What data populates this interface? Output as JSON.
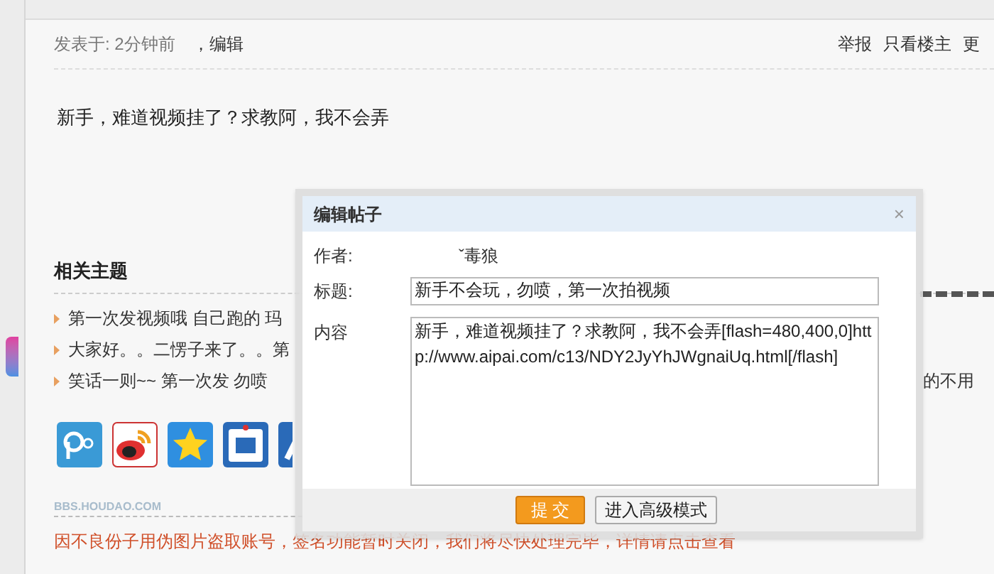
{
  "post_header": {
    "posted": "发表于: 2分钟前",
    "edit_link": "，编辑",
    "actions": [
      "举报",
      "只看楼主",
      "更"
    ]
  },
  "post_body": "新手，难道视频挂了？求教阿，我不会弄",
  "related": {
    "title": "相关主题",
    "items": [
      {
        "text": "第一次发视频哦  自己跑的 玛"
      },
      {
        "text": "大家好。。二愣子来了。。第"
      },
      {
        "text": "笑话一则~~ 第一次发 勿喷",
        "aside": "的不用"
      }
    ]
  },
  "share_icons": [
    {
      "kind": "circle"
    },
    {
      "kind": "weibo"
    },
    {
      "kind": "star"
    },
    {
      "kind": "tie"
    },
    {
      "kind": "partial"
    }
  ],
  "signature": {
    "site": "BBS.HOUDAO.COM",
    "notice": "因不良份子用伪图片盗取账号，签名功能暂时关闭，我们将尽快处理完毕，详情请点击查看"
  },
  "dialog": {
    "title": "编辑帖子",
    "close": "×",
    "author_label": "作者:",
    "author": "ˇ毒狼",
    "title_label": "标题:",
    "title_value": "新手不会玩，勿喷，第一次拍视频",
    "content_label": "内容",
    "content_value": "新手，难道视频挂了？求教阿，我不会弄[flash=480,400,0]http://www.aipai.com/c13/NDY2JyYhJWgnaiUq.html[/flash]",
    "buttons": [
      {
        "label": "提 交",
        "kind": "primary"
      },
      {
        "label": "进入高级模式",
        "kind": "secondary"
      }
    ]
  }
}
